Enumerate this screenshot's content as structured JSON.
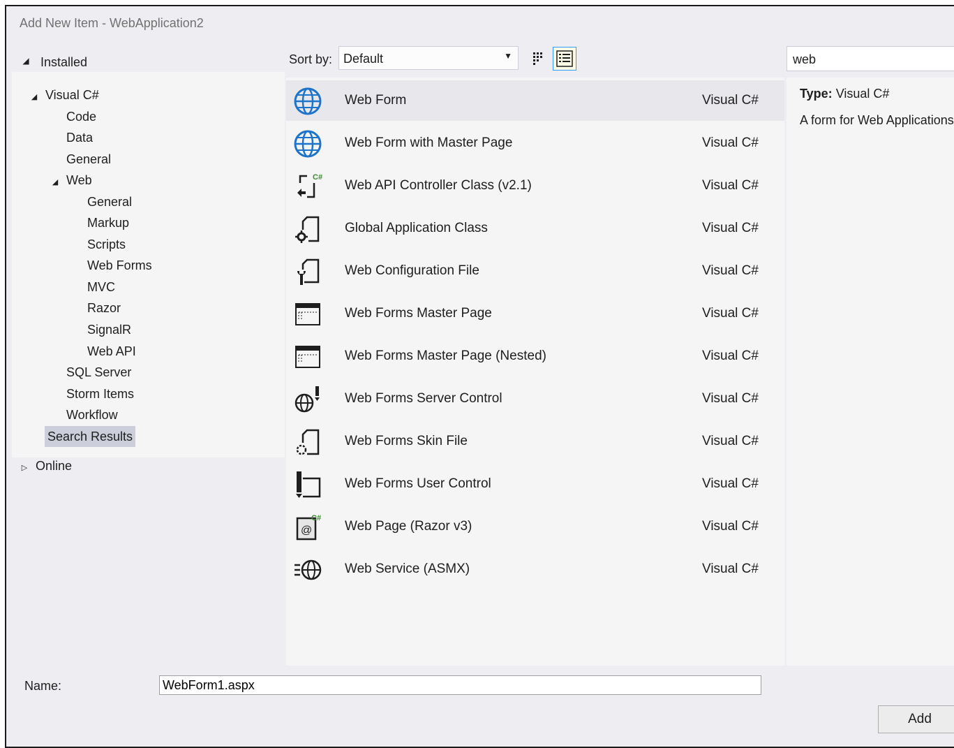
{
  "window": {
    "title": "Add New Item - WebApplication2"
  },
  "left_panel": {
    "installed_label": "Installed",
    "tree": {
      "visual_csharp": "Visual C#",
      "code": "Code",
      "data": "Data",
      "general": "General",
      "web": "Web",
      "web_general": "General",
      "markup": "Markup",
      "scripts": "Scripts",
      "web_forms": "Web Forms",
      "mvc": "MVC",
      "razor": "Razor",
      "signalr": "SignalR",
      "web_api": "Web API",
      "sql_server": "SQL Server",
      "storm_items": "Storm Items",
      "workflow": "Workflow",
      "search_results": "Search Results"
    },
    "online_label": "Online"
  },
  "toolbar": {
    "sort_label": "Sort by:",
    "sort_value": "Default",
    "search_value": "web"
  },
  "items": [
    {
      "name": "Web Form",
      "lang": "Visual C#",
      "icon": "globe-icon"
    },
    {
      "name": "Web Form with Master Page",
      "lang": "Visual C#",
      "icon": "globe-icon"
    },
    {
      "name": "Web API Controller Class (v2.1)",
      "lang": "Visual C#",
      "icon": "controller-class-icon"
    },
    {
      "name": "Global Application Class",
      "lang": "Visual C#",
      "icon": "gear-file-icon"
    },
    {
      "name": "Web Configuration File",
      "lang": "Visual C#",
      "icon": "wrench-file-icon"
    },
    {
      "name": "Web Forms Master Page",
      "lang": "Visual C#",
      "icon": "master-page-icon"
    },
    {
      "name": "Web Forms Master Page (Nested)",
      "lang": "Visual C#",
      "icon": "master-page-icon"
    },
    {
      "name": "Web Forms Server Control",
      "lang": "Visual C#",
      "icon": "globe-control-icon"
    },
    {
      "name": "Web Forms Skin File",
      "lang": "Visual C#",
      "icon": "skin-file-icon"
    },
    {
      "name": "Web Forms User Control",
      "lang": "Visual C#",
      "icon": "user-control-icon"
    },
    {
      "name": "Web Page (Razor v3)",
      "lang": "Visual C#",
      "icon": "razor-page-icon"
    },
    {
      "name": "Web Service (ASMX)",
      "lang": "Visual C#",
      "icon": "web-service-icon"
    }
  ],
  "details": {
    "type_label": "Type:",
    "type_value": "Visual C#",
    "description": "A form for Web Applications"
  },
  "footer": {
    "name_label": "Name:",
    "name_value": "WebForm1.aspx",
    "add_label": "Add"
  },
  "colors": {
    "accent_blue": "#1e74c9",
    "selection": "#cccedb",
    "dialog_bg": "#eeeef2"
  }
}
